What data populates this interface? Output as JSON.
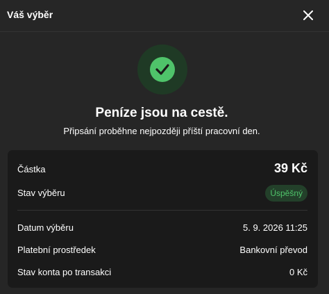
{
  "header": {
    "title": "Váš výběr"
  },
  "status": {
    "headline": "Peníze jsou na cestě.",
    "subline": "Připsání proběhne nejpozději příští pracovní den."
  },
  "details": {
    "amount": {
      "label": "Částka",
      "value": "39 Kč"
    },
    "withdrawal_status": {
      "label": "Stav výběru",
      "value": "Úspěšný"
    },
    "date": {
      "label": "Datum výběru",
      "value": "5. 9. 2026 11:25"
    },
    "payment_method": {
      "label": "Platební prostředek",
      "value": "Bankovní převod"
    },
    "balance_after": {
      "label": "Stav konta po transakci",
      "value": "0 Kč"
    }
  },
  "colors": {
    "background": "#262626",
    "card": "#1a1a1a",
    "success": "#4fc36a",
    "success_bg": "#1f3a25"
  },
  "icons": {
    "close": "close-icon",
    "success": "checkmark-icon"
  }
}
